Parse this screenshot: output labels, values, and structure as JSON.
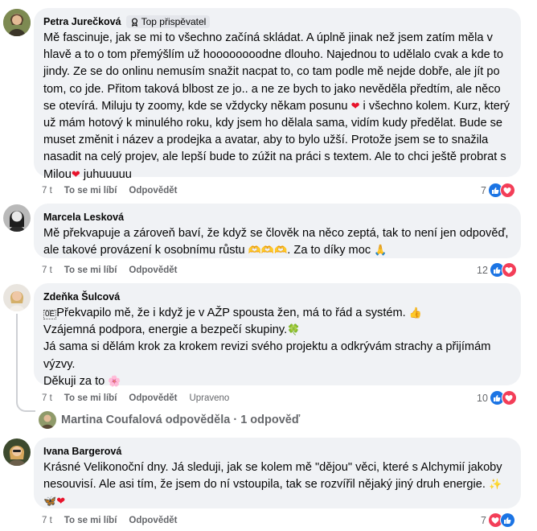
{
  "comments": [
    {
      "author": "Petra Jurečková",
      "badge": "Top přispěvatel",
      "text": "Mě fascinuje, jak se mi to všechno začíná skládat. A úplně jinak než jsem zatím měla v hlavě a to o tom přemýšlím už hoooooooodne dlouho. Najednou to udělalo cvak a kde to jindy. Ze se do onlinu nemusím snažit nacpat to, co tam podle mě nejde dobře, ale jít po tom, co jde. Přitom taková blbost ze jo.. a ne ze bych to jako nevěděla předtím, ale něco se otevírá. Miluju ty zoomy, kde se vždycky někam posunu",
      "text_b": " i všechno kolem. Kurz, který už mám hotový k minulého roku, kdy jsem ho dělala sama, vidím kudy předělat. Bude se muset změnit i název a prodejka a avatar, aby to bylo užší. Protože jsem se to snažila nasadit na celý projev, ale lepší bude to zúžit na práci s textem. Ale to chci ještě probrat s Milou",
      "text_c": " juhuuuuu",
      "time": "7 t",
      "like": "To se mi líbí",
      "reply": "Odpovědět",
      "count": "7"
    },
    {
      "author": "Marcela Lesková",
      "text": "Mě překvapuje a zároveň baví, že když se člověk na něco zeptá, tak to není jen odpověď, ale takové provázení k osobnímu růstu",
      "text_b": " Za to díky moc",
      "time": "7 t",
      "like": "To se mi líbí",
      "reply": "Odpovědět",
      "count": "12"
    },
    {
      "author": "Zdeňka Šulcová",
      "line1": "Překvapilo mě, že i když je v AŽP spousta žen, má to řád a systém.",
      "line2": "Vzájemná podpora, energie a bezpečí skupiny.",
      "line3": "Já sama si dělám krok za krokem revizi svého projektu a odkrývám strachy a přijímám výzvy.",
      "line4": "Děkuji za to",
      "time": "7 t",
      "like": "To se mi líbí",
      "reply": "Odpovědět",
      "edited": "Upraveno",
      "count": "10"
    },
    {
      "author": "Ivana Bargerová",
      "text": "Krásné Velikonoční dny. Já sleduji, jak se kolem mě \"dějou\" věci, které s Alchymií jakoby nesouvisí. Ale asi tím, že jsem do ní vstoupila, tak se rozvířil nějaký jiný druh energie.",
      "time": "7 t",
      "like": "To se mi líbí",
      "reply": "Odpovědět",
      "count": "7"
    }
  ],
  "replies": {
    "author": "Martina Coufalová",
    "label": "odpověděla",
    "sep": "·",
    "count_label": "1 odpověď"
  },
  "colors": {
    "bubble": "#f0f2f5",
    "like_blue": "#1b74e4",
    "heart_red": "#f33e58",
    "muted": "#65676b"
  }
}
